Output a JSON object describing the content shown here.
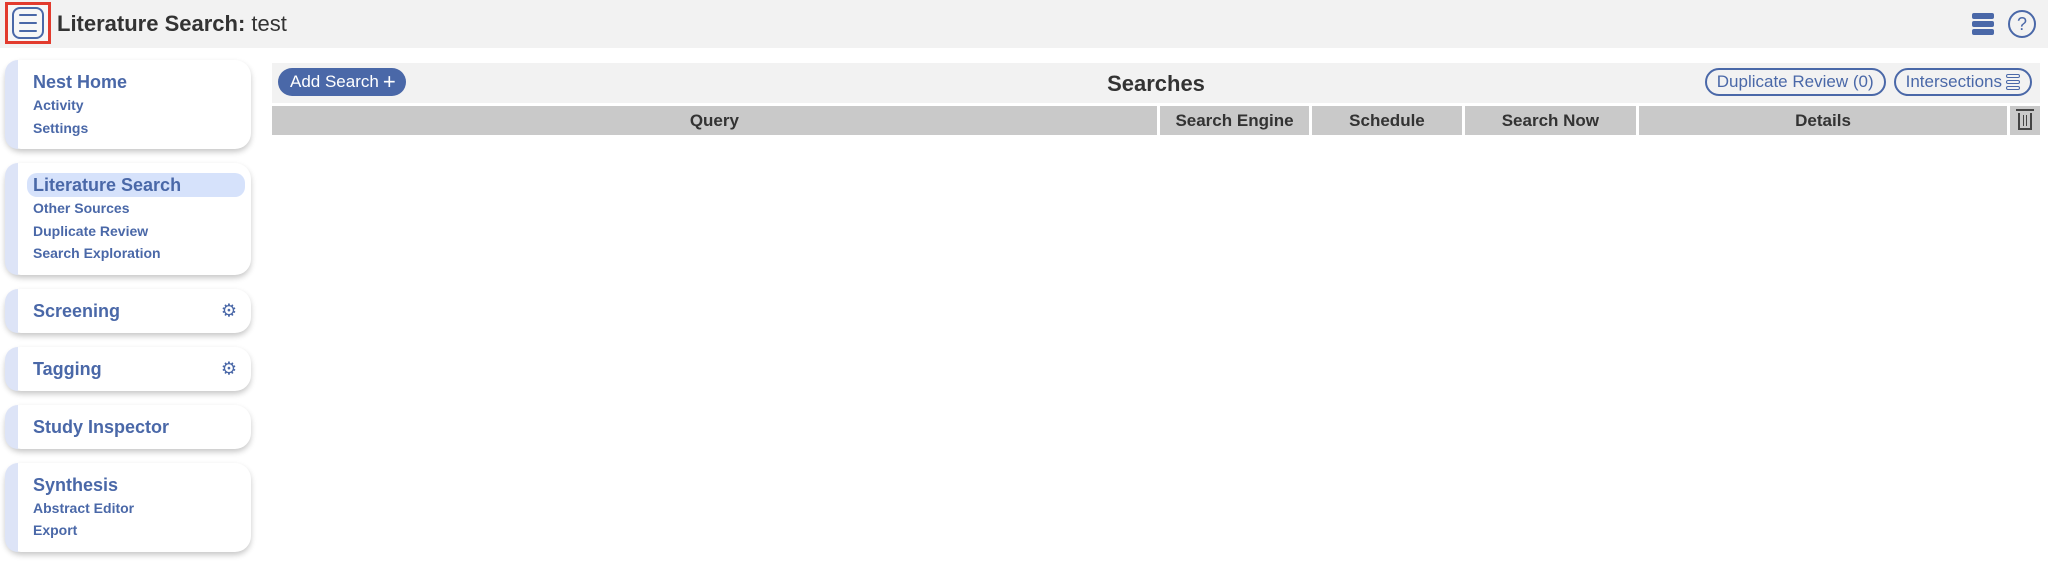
{
  "topbar": {
    "title_bold": "Literature Search:",
    "title_rest": " test"
  },
  "sidebar": {
    "cards": [
      {
        "title": "Nest Home",
        "items": [
          "Activity",
          "Settings"
        ]
      },
      {
        "title": "Literature Search",
        "items": [
          "Other Sources",
          "Duplicate Review",
          "Search Exploration"
        ]
      },
      {
        "title": "Screening",
        "items": []
      },
      {
        "title": "Tagging",
        "items": []
      },
      {
        "title": "Study Inspector",
        "items": []
      },
      {
        "title": "Synthesis",
        "items": [
          "Abstract Editor",
          "Export"
        ]
      }
    ]
  },
  "main": {
    "add_label": "Add Search",
    "title": "Searches",
    "duplicate_label": "Duplicate Review (0)",
    "intersections_label": "Intersections",
    "columns": [
      "Query",
      "Search Engine",
      "Schedule",
      "Search Now",
      "Details"
    ]
  },
  "colors": {
    "accent": "#4a68a8",
    "highlight": "#e23b2e",
    "header_bg": "#c9c9c9"
  }
}
